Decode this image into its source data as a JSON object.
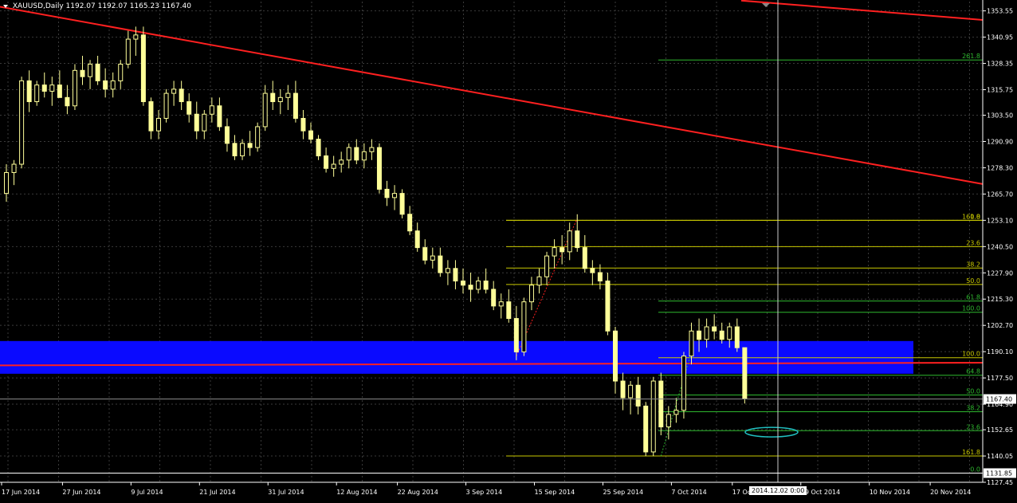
{
  "header": {
    "symbol": "XAUUSD,Daily",
    "ohlc": "1192.07 1192.07 1165.23 1167.40"
  },
  "cursor_date": "2014.12.02 0:00",
  "colors": {
    "background": "#000000",
    "grid": "#3a3a3a",
    "bull_candle": "#000000",
    "bear_candle": "#ffff99",
    "wick": "#ffff99",
    "trendline": "#ff2020",
    "zone": "#0a0aff",
    "fib_yellow": "#c8c800",
    "fib_green": "#2eb82e",
    "ellipse": "#20c0c0",
    "axis_text": "#ffffff"
  },
  "chart_data": {
    "type": "candlestick",
    "instrument": "XAUUSD",
    "timeframe": "Daily",
    "ylim": [
      1127.45,
      1358.0
    ],
    "y_ticks": [
      "1353.55",
      "1340.95",
      "1328.35",
      "1315.75",
      "1303.50",
      "1290.90",
      "1278.30",
      "1265.70",
      "1253.10",
      "1240.50",
      "1227.90",
      "1215.30",
      "1202.70",
      "1190.10",
      "1177.50",
      "1164.90",
      "1152.65",
      "1140.05",
      "1127.45"
    ],
    "x_ticks": [
      "17 Jun 2014",
      "27 Jun 2014",
      "9 Jul 2014",
      "21 Jul 2014",
      "31 Jul 2014",
      "12 Aug 2014",
      "22 Aug 2014",
      "3 Sep 2014",
      "15 Sep 2014",
      "25 Sep 2014",
      "7 Oct 2014",
      "17 Oct 2014",
      "29 Oct 2014",
      "10 Nov 2014",
      "20 Nov 2014"
    ],
    "x_tick_bars": [
      0,
      8,
      17,
      26,
      35,
      44,
      52,
      61,
      70,
      79,
      88,
      96,
      105,
      114,
      122
    ],
    "current_price_label": "1167.40",
    "current_price": 1167.4,
    "low_price_label": "1131.85",
    "low_price": 1131.85,
    "ohlc": [
      [
        1266,
        1280,
        1262,
        1276
      ],
      [
        1276,
        1282,
        1270,
        1280
      ],
      [
        1280,
        1322,
        1278,
        1320
      ],
      [
        1320,
        1325,
        1305,
        1310
      ],
      [
        1310,
        1320,
        1308,
        1318
      ],
      [
        1318,
        1324,
        1312,
        1315
      ],
      [
        1315,
        1322,
        1308,
        1318
      ],
      [
        1318,
        1325,
        1312,
        1312
      ],
      [
        1312,
        1318,
        1304,
        1308
      ],
      [
        1308,
        1328,
        1306,
        1325
      ],
      [
        1325,
        1332,
        1318,
        1322
      ],
      [
        1322,
        1330,
        1316,
        1328
      ],
      [
        1328,
        1332,
        1318,
        1320
      ],
      [
        1320,
        1326,
        1312,
        1316
      ],
      [
        1316,
        1324,
        1312,
        1320
      ],
      [
        1320,
        1330,
        1316,
        1328
      ],
      [
        1328,
        1344,
        1326,
        1340
      ],
      [
        1340,
        1346,
        1332,
        1342
      ],
      [
        1342,
        1346,
        1308,
        1310
      ],
      [
        1310,
        1312,
        1292,
        1296
      ],
      [
        1296,
        1306,
        1292,
        1302
      ],
      [
        1302,
        1316,
        1300,
        1314
      ],
      [
        1314,
        1320,
        1308,
        1316
      ],
      [
        1316,
        1320,
        1306,
        1310
      ],
      [
        1310,
        1314,
        1300,
        1304
      ],
      [
        1304,
        1310,
        1292,
        1296
      ],
      [
        1296,
        1306,
        1292,
        1304
      ],
      [
        1304,
        1312,
        1300,
        1308
      ],
      [
        1308,
        1312,
        1296,
        1298
      ],
      [
        1298,
        1302,
        1286,
        1290
      ],
      [
        1290,
        1294,
        1282,
        1284
      ],
      [
        1284,
        1292,
        1282,
        1290
      ],
      [
        1290,
        1296,
        1284,
        1288
      ],
      [
        1288,
        1300,
        1286,
        1298
      ],
      [
        1298,
        1318,
        1296,
        1314
      ],
      [
        1314,
        1320,
        1306,
        1310
      ],
      [
        1310,
        1316,
        1304,
        1312
      ],
      [
        1312,
        1318,
        1306,
        1314
      ],
      [
        1314,
        1320,
        1300,
        1302
      ],
      [
        1302,
        1306,
        1292,
        1296
      ],
      [
        1296,
        1300,
        1290,
        1292
      ],
      [
        1292,
        1294,
        1282,
        1284
      ],
      [
        1284,
        1288,
        1276,
        1278
      ],
      [
        1278,
        1284,
        1274,
        1280
      ],
      [
        1280,
        1286,
        1276,
        1282
      ],
      [
        1282,
        1290,
        1278,
        1288
      ],
      [
        1288,
        1292,
        1280,
        1282
      ],
      [
        1282,
        1290,
        1278,
        1286
      ],
      [
        1286,
        1292,
        1282,
        1288
      ],
      [
        1288,
        1290,
        1266,
        1268
      ],
      [
        1268,
        1272,
        1260,
        1264
      ],
      [
        1264,
        1270,
        1258,
        1266
      ],
      [
        1266,
        1268,
        1254,
        1256
      ],
      [
        1256,
        1260,
        1246,
        1248
      ],
      [
        1248,
        1252,
        1238,
        1240
      ],
      [
        1240,
        1244,
        1232,
        1234
      ],
      [
        1234,
        1240,
        1230,
        1236
      ],
      [
        1236,
        1240,
        1226,
        1228
      ],
      [
        1228,
        1234,
        1222,
        1230
      ],
      [
        1230,
        1234,
        1220,
        1224
      ],
      [
        1224,
        1230,
        1218,
        1222
      ],
      [
        1222,
        1228,
        1214,
        1220
      ],
      [
        1220,
        1226,
        1218,
        1224
      ],
      [
        1224,
        1230,
        1218,
        1220
      ],
      [
        1220,
        1224,
        1210,
        1212
      ],
      [
        1212,
        1218,
        1206,
        1214
      ],
      [
        1214,
        1220,
        1204,
        1206
      ],
      [
        1206,
        1212,
        1186,
        1190
      ],
      [
        1190,
        1216,
        1188,
        1214
      ],
      [
        1214,
        1226,
        1210,
        1222
      ],
      [
        1222,
        1230,
        1218,
        1226
      ],
      [
        1226,
        1238,
        1222,
        1236
      ],
      [
        1236,
        1244,
        1230,
        1240
      ],
      [
        1240,
        1246,
        1232,
        1238
      ],
      [
        1238,
        1252,
        1234,
        1248
      ],
      [
        1248,
        1256,
        1238,
        1240
      ],
      [
        1240,
        1246,
        1228,
        1230
      ],
      [
        1230,
        1234,
        1222,
        1228
      ],
      [
        1228,
        1232,
        1220,
        1224
      ],
      [
        1224,
        1228,
        1198,
        1200
      ],
      [
        1200,
        1202,
        1170,
        1176
      ],
      [
        1176,
        1180,
        1162,
        1168
      ],
      [
        1168,
        1176,
        1160,
        1174
      ],
      [
        1174,
        1178,
        1160,
        1164
      ],
      [
        1164,
        1166,
        1140,
        1142
      ],
      [
        1142,
        1178,
        1140,
        1176
      ],
      [
        1176,
        1180,
        1150,
        1154
      ],
      [
        1154,
        1164,
        1148,
        1160
      ],
      [
        1160,
        1168,
        1156,
        1162
      ],
      [
        1162,
        1190,
        1158,
        1188
      ],
      [
        1188,
        1204,
        1184,
        1200
      ],
      [
        1200,
        1206,
        1190,
        1196
      ],
      [
        1196,
        1206,
        1192,
        1202
      ],
      [
        1202,
        1208,
        1196,
        1200
      ],
      [
        1200,
        1204,
        1194,
        1196
      ],
      [
        1196,
        1204,
        1192,
        1202
      ],
      [
        1202,
        1206,
        1190,
        1192
      ],
      [
        1192,
        1192,
        1165.23,
        1167.4
      ]
    ],
    "fib_upper_labels": [
      "0.0",
      "161.8",
      "23.6",
      "38.2",
      "50.0",
      "61.8",
      "100.0"
    ],
    "fib_upper_levels": [
      1253.1,
      1253.1,
      1240.5,
      1230.2,
      1222.3,
      1214.4,
      1209.0
    ],
    "fib_lower_labels": [
      "261.8",
      "100.0",
      "64.8",
      "50.0",
      "38.2",
      "23.6",
      "161.8",
      "0.0"
    ],
    "fib_lower_levels": [
      1330.0,
      1187.2,
      1178.8,
      1169.3,
      1161.3,
      1152.2,
      1140.05,
      1131.85
    ]
  }
}
